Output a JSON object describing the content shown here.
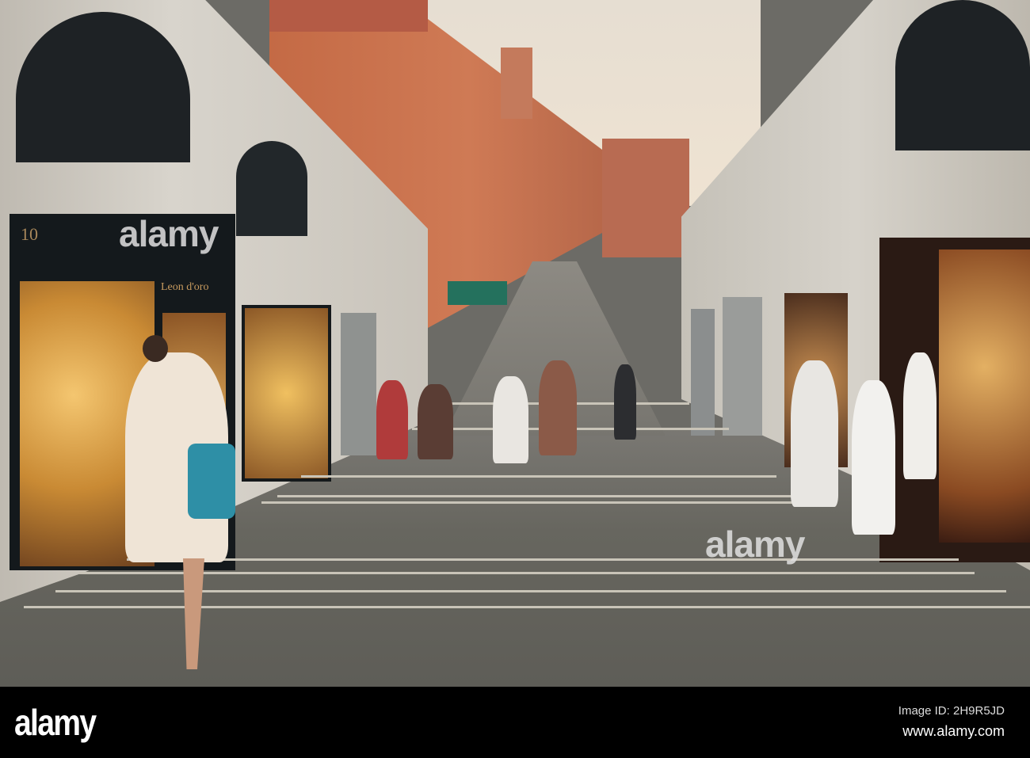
{
  "photo": {
    "shop_number": "10",
    "shop_sign": "Leon d'oro",
    "watermarks": [
      "alamy",
      "alamy"
    ]
  },
  "footer": {
    "logo": "alamy",
    "image_id": "Image ID: 2H9R5JD",
    "website": "www.alamy.com"
  },
  "colors": {
    "sky": "#e9e1d6",
    "building": "#c9704c",
    "stone": "#cfccc4",
    "floor": "#6c6b66",
    "shop_glow": "#d9a13e"
  }
}
